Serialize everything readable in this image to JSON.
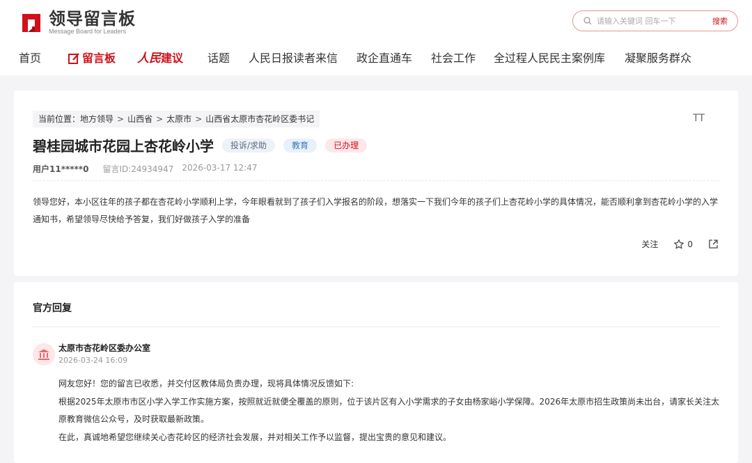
{
  "header": {
    "logo_title": "领导留言板",
    "logo_subtitle": "Message Board for Leaders",
    "search_placeholder": "请输入关键词 回车一下",
    "search_button": "搜索"
  },
  "nav": {
    "items": [
      {
        "label": "首页"
      },
      {
        "label": "留言板"
      },
      {
        "label_a": "人民",
        "label_b": "建议"
      },
      {
        "label": "话题"
      },
      {
        "label": "人民日报读者来信"
      },
      {
        "label": "政企直通车"
      },
      {
        "label": "社会工作"
      },
      {
        "label": "全过程人民民主案例库"
      },
      {
        "label": "凝聚服务群众"
      }
    ]
  },
  "breadcrumb": {
    "prefix": "当前位置：",
    "items": [
      "地方领导",
      "山西省",
      "太原市",
      "山西省太原市杏花岭区委书记"
    ],
    "separator": ">"
  },
  "font_toggle": "TT",
  "message": {
    "title": "碧桂园城市花园上杏花岭小学",
    "tags": [
      "投诉/求助",
      "教育",
      "已办理"
    ],
    "user": "用户11*****0",
    "id_label": "留言ID:24934947",
    "time": "2026-03-17 12:47",
    "content": "领导您好，本小区往年的孩子都在杏花岭小学顺利上学，今年眼看就到了孩子们入学报名的阶段，想落实一下我们今年的孩子们上杏花岭小学的具体情况，能否顺利拿到杏花岭小学的入学通知书，希望领导尽快给予答复，我们好做孩子入学的准备",
    "follow_label": "关注",
    "favorite_count": "0"
  },
  "reply": {
    "heading": "官方回复",
    "org_name": "太原市杏花岭区委办公室",
    "time": "2026-03-24 16:09",
    "paragraphs": [
      "网友您好！您的留言已收悉，并交付区教体局负责办理，现将具体情况反馈如下:",
      "根据2025年太原市市区小学入学工作实施方案，按照就近就便全覆盖的原则，位于该片区有入小学需求的子女由杨家峪小学保障。2026年太原市招生政策尚未出台，请家长关注太原教育微信公众号，及时获取最新政策。",
      "在此，真诚地希望您继续关心杏花岭区的经济社会发展，并对相关工作予以监督，提出宝贵的意见和建议。"
    ]
  },
  "colors": {
    "brand_red": "#d0111b",
    "page_bg": "#f4f4f6"
  }
}
